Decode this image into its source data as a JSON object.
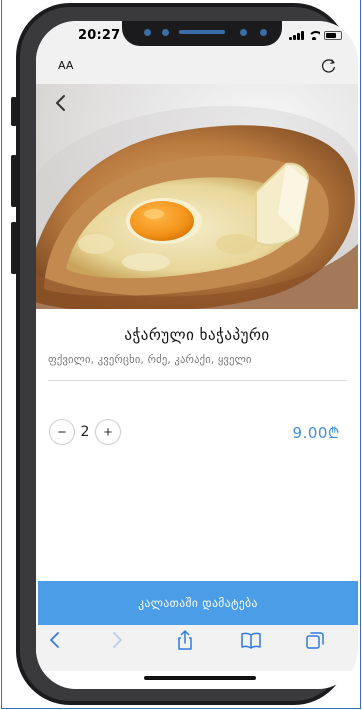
{
  "status_bar": {
    "time": "20:27"
  },
  "browser": {
    "text_size_label": "AA"
  },
  "product": {
    "name": "აჭარული ხაჭაპური",
    "ingredients": "ფქვილი, კვერცხი, რძე, კარაქი, ყველი",
    "quantity": "2",
    "price": "9.00₾",
    "decrement": "−",
    "increment": "+"
  },
  "actions": {
    "add_to_cart": "კალათაში დამატება"
  },
  "icons": {
    "back": "chevron-left-icon",
    "reload": "reload-icon",
    "toolbar": [
      "chevron-left-icon",
      "chevron-right-icon",
      "share-icon",
      "book-icon",
      "tabs-icon"
    ]
  },
  "colors": {
    "accent": "#4a9de6",
    "price": "#3f8fd9",
    "toolbar_icon": "#2f7be0"
  }
}
